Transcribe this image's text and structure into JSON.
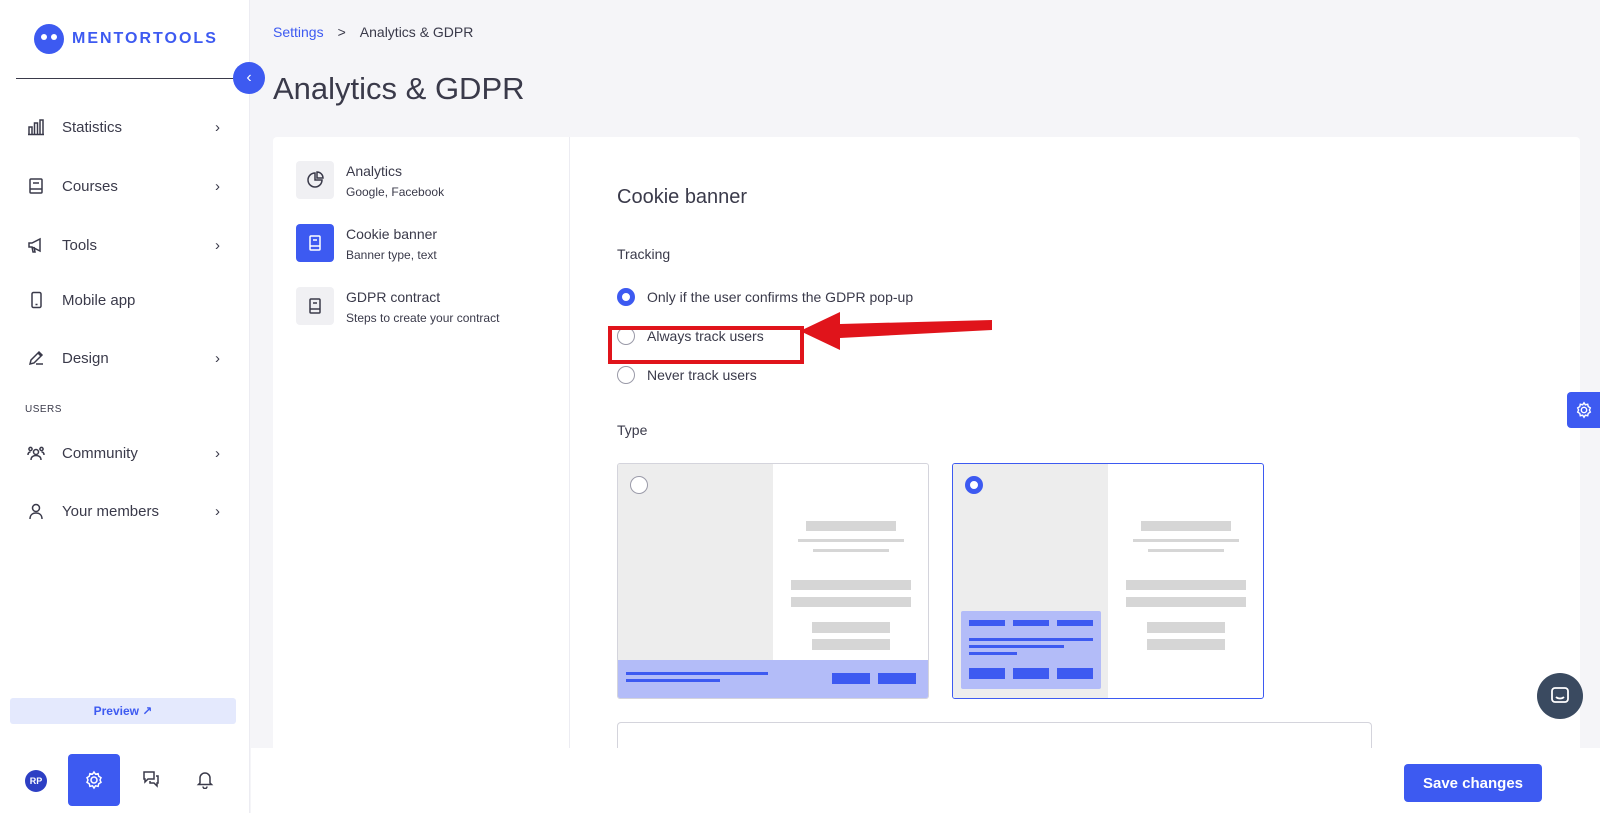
{
  "brand": {
    "name": "MENTORTOOLS"
  },
  "sidebar": {
    "items": [
      {
        "label": "Statistics",
        "icon": "bar-chart-icon",
        "has_chevron": true
      },
      {
        "label": "Courses",
        "icon": "book-icon",
        "has_chevron": true
      },
      {
        "label": "Tools",
        "icon": "megaphone-icon",
        "has_chevron": true
      },
      {
        "label": "Mobile app",
        "icon": "smartphone-icon",
        "has_chevron": false
      },
      {
        "label": "Design",
        "icon": "pencil-icon",
        "has_chevron": true
      }
    ],
    "section_label": "USERS",
    "user_items": [
      {
        "label": "Community",
        "icon": "people-icon",
        "has_chevron": true
      },
      {
        "label": "Your members",
        "icon": "person-icon",
        "has_chevron": true
      }
    ],
    "preview_label": "Preview ↗",
    "avatar_initials": "RP",
    "chevron": "›",
    "collapse": "‹"
  },
  "breadcrumb": {
    "parent": "Settings",
    "separator": ">",
    "current": "Analytics & GDPR"
  },
  "page_title": "Analytics & GDPR",
  "subnav": [
    {
      "title": "Analytics",
      "desc": "Google, Facebook",
      "icon": "pie-chart-icon",
      "active": false
    },
    {
      "title": "Cookie banner",
      "desc": "Banner type, text",
      "icon": "document-icon",
      "active": true
    },
    {
      "title": "GDPR contract",
      "desc": "Steps to create your contract",
      "icon": "document-icon",
      "active": false
    }
  ],
  "cookie": {
    "title": "Cookie banner",
    "tracking_label": "Tracking",
    "options": [
      {
        "label": "Only if the user confirms the GDPR pop-up",
        "checked": true
      },
      {
        "label": "Always track users",
        "checked": false
      },
      {
        "label": "Never track users",
        "checked": false
      }
    ],
    "type_label": "Type",
    "types": [
      {
        "name": "bottom-bar-banner",
        "selected": false
      },
      {
        "name": "floating-box-banner",
        "selected": true
      }
    ]
  },
  "footer": {
    "save_label": "Save changes"
  },
  "colors": {
    "accent": "#3d5af1",
    "highlight": "#e0141b",
    "chat": "#3a4a60"
  }
}
